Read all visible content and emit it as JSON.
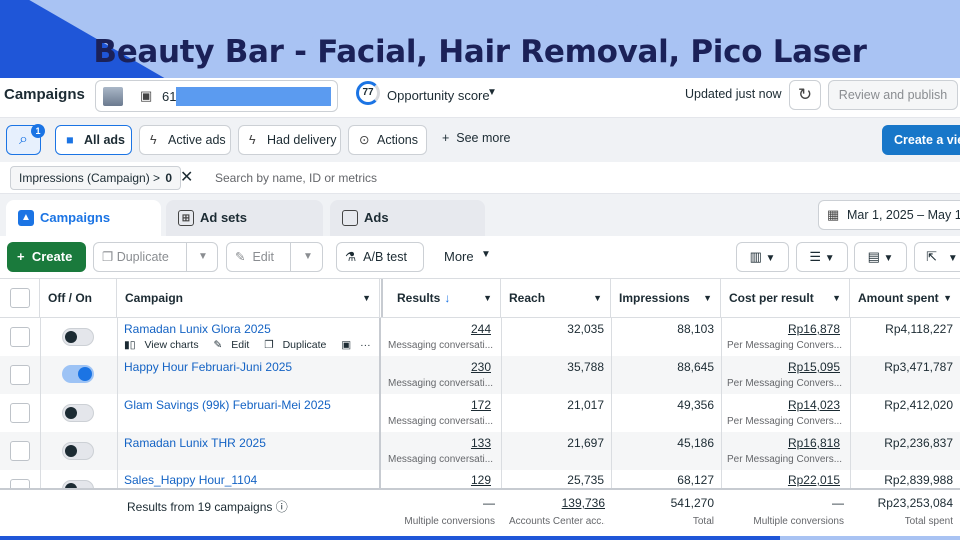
{
  "banner": {
    "title": "Beauty Bar - Facial, Hair Removal, Pico Laser"
  },
  "topbar": {
    "title": "Campaigns",
    "account_id": "616",
    "opportunity_score": "77",
    "opportunity_label": "Opportunity score",
    "updated": "Updated just now",
    "review_label": "Review and publish"
  },
  "filters": {
    "search_badge": "1",
    "all_ads": "All ads",
    "active_ads": "Active ads",
    "had_delivery": "Had delivery",
    "actions": "Actions",
    "see_more": "See more",
    "create_view": "Create a view"
  },
  "search": {
    "chip_label": "Impressions (Campaign) >",
    "chip_value": "0",
    "placeholder": "Search by name, ID or metrics"
  },
  "tabs": {
    "campaigns": "Campaigns",
    "ad_sets": "Ad sets",
    "ads": "Ads",
    "date_range": "Mar 1, 2025 – May 1,"
  },
  "toolbar": {
    "create": "Create",
    "duplicate": "Duplicate",
    "edit": "Edit",
    "ab_test": "A/B test",
    "more": "More"
  },
  "table": {
    "headers": {
      "off_on": "Off / On",
      "campaign": "Campaign",
      "results": "Results",
      "reach": "Reach",
      "impressions": "Impressions",
      "cost": "Cost per result",
      "amount": "Amount spent"
    },
    "row_actions": {
      "view_charts": "View charts",
      "edit": "Edit",
      "duplicate": "Duplicate",
      "more": "···"
    },
    "rows": [
      {
        "name": "Ramadan Lunix Glora 2025",
        "on": false,
        "results": "244",
        "results_sub": "Messaging conversati...",
        "reach": "32,035",
        "impressions": "88,103",
        "cost": "Rp16,878",
        "cost_sub": "Per Messaging Convers...",
        "amount": "Rp4,118,227"
      },
      {
        "name": "Happy Hour Februari-Juni 2025",
        "on": true,
        "results": "230",
        "results_sub": "Messaging conversati...",
        "reach": "35,788",
        "impressions": "88,645",
        "cost": "Rp15,095",
        "cost_sub": "Per Messaging Convers...",
        "amount": "Rp3,471,787"
      },
      {
        "name": "Glam Savings (99k) Februari-Mei 2025",
        "on": false,
        "results": "172",
        "results_sub": "Messaging conversati...",
        "reach": "21,017",
        "impressions": "49,356",
        "cost": "Rp14,023",
        "cost_sub": "Per Messaging Convers...",
        "amount": "Rp2,412,020"
      },
      {
        "name": "Ramadan Lunix THR 2025",
        "on": false,
        "results": "133",
        "results_sub": "Messaging conversati...",
        "reach": "21,697",
        "impressions": "45,186",
        "cost": "Rp16,818",
        "cost_sub": "Per Messaging Convers...",
        "amount": "Rp2,236,837"
      },
      {
        "name": "Sales_Happy Hour_1104",
        "on": false,
        "results": "129",
        "results_sub": "",
        "reach": "25,735",
        "impressions": "68,127",
        "cost": "Rp22,015",
        "cost_sub": "",
        "amount": "Rp2,839,988"
      }
    ],
    "footer": {
      "label": "Results from 19 campaigns",
      "results": "—",
      "results_sub": "Multiple conversions",
      "reach": "139,736",
      "reach_sub": "Accounts Center acc...",
      "impressions": "541,270",
      "impressions_sub": "Total",
      "cost": "—",
      "cost_sub": "Multiple conversions",
      "amount": "Rp23,253,084",
      "amount_sub": "Total spent"
    }
  }
}
